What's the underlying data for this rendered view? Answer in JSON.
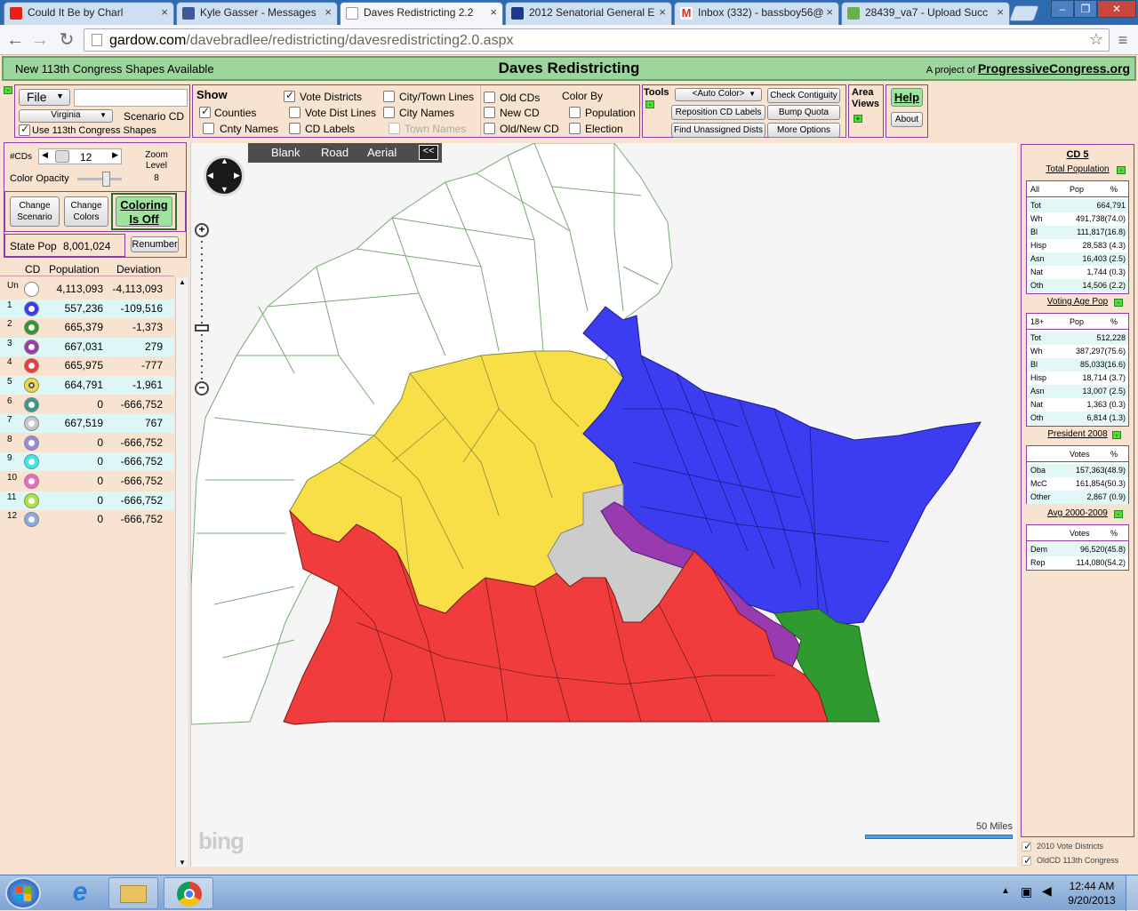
{
  "browser": {
    "tabs": [
      {
        "title": "Could It Be by Charl",
        "color": "#e62117"
      },
      {
        "title": "Kyle Gasser - Messages",
        "color": "#3b5998"
      },
      {
        "title": "Daves Redistricting 2.2",
        "color": "#ffffff"
      },
      {
        "title": "2012 Senatorial General E",
        "color": "#1a3a8c"
      },
      {
        "title": "Inbox (332) - bassboy56@",
        "color": "#d93025"
      },
      {
        "title": "28439_va7 - Upload Succ",
        "color": "#6ab04c"
      }
    ],
    "url_host": "gardow.com",
    "url_path": "/davebradlee/redistricting/davesredistricting2.0.aspx",
    "window_controls": [
      "–",
      "❐",
      "✕"
    ]
  },
  "header": {
    "notice": "New 113th Congress Shapes Available",
    "title": "Daves Redistricting",
    "project_prefix": "A project of",
    "project_link": "ProgressiveCongress.org"
  },
  "toolbar": {
    "file_label": "File",
    "state_select": "Virginia",
    "scenario": "Scenario CD",
    "use_shapes": "Use 113th Congress Shapes",
    "show_title": "Show",
    "show_items": {
      "counties": "Counties",
      "cnty_names": "Cnty Names",
      "vote_districts": "Vote Districts",
      "vote_dist_lines": "Vote Dist Lines",
      "cd_labels": "CD Labels",
      "city_town_lines": "City/Town Lines",
      "city_names": "City Names",
      "town_names": "Town Names"
    },
    "cd_items": {
      "old_cds": "Old CDs",
      "new_cd": "New CD",
      "old_new_cd": "Old/New CD"
    },
    "color_by": {
      "title": "Color By",
      "population": "Population",
      "election": "Election"
    },
    "tools_title": "Tools",
    "auto_color": "<Auto Color>",
    "reposition": "Reposition CD Labels",
    "find_unassigned": "Find Unassigned Dists",
    "check_contiguity": "Check Contiguity",
    "bump_quota": "Bump Quota",
    "more_options": "More Options",
    "area_views": "Area Views",
    "help": "Help",
    "about": "About"
  },
  "controls": {
    "num_cds_label": "#CDs",
    "num_cds": "12",
    "zoom_label": "Zoom Level",
    "zoom": "8",
    "color_opacity": "Color Opacity",
    "change_scenario": "Change Scenario",
    "change_colors": "Change Colors",
    "coloring": "Coloring Is Off",
    "state_pop_label": "State Pop",
    "state_pop": "8,001,024",
    "renumber": "Renumber"
  },
  "cd_table": {
    "headers": [
      "CD",
      "Population",
      "Deviation"
    ],
    "rows": [
      {
        "cd": "Un",
        "color": "#ffffff",
        "pop": "4,113,093",
        "dev": "-4,113,093"
      },
      {
        "cd": "1",
        "color": "#3b3bf5",
        "pop": "557,236",
        "dev": "-109,516"
      },
      {
        "cd": "2",
        "color": "#2e9a2e",
        "pop": "665,379",
        "dev": "-1,373"
      },
      {
        "cd": "3",
        "color": "#9b3aa8",
        "pop": "667,031",
        "dev": "279"
      },
      {
        "cd": "4",
        "color": "#f03c3c",
        "pop": "665,975",
        "dev": "-777"
      },
      {
        "cd": "5",
        "color": "#f5d83a",
        "pop": "664,791",
        "dev": "-1,961"
      },
      {
        "cd": "6",
        "color": "#3a9a8a",
        "pop": "0",
        "dev": "-666,752"
      },
      {
        "cd": "7",
        "color": "#c8c8c8",
        "pop": "667,519",
        "dev": "767"
      },
      {
        "cd": "8",
        "color": "#9a8ad8",
        "pop": "0",
        "dev": "-666,752"
      },
      {
        "cd": "9",
        "color": "#38e8f0",
        "pop": "0",
        "dev": "-666,752"
      },
      {
        "cd": "10",
        "color": "#f068c8",
        "pop": "0",
        "dev": "-666,752"
      },
      {
        "cd": "11",
        "color": "#a8e838",
        "pop": "0",
        "dev": "-666,752"
      },
      {
        "cd": "12",
        "color": "#88a8e8",
        "pop": "0",
        "dev": "-666,752"
      }
    ]
  },
  "map": {
    "modes": [
      "Blank",
      "Road",
      "Aerial"
    ],
    "collapse": "<<",
    "scale": "50 Miles",
    "brand": "bing"
  },
  "stats": {
    "title": "CD 5",
    "total_pop": {
      "title": "Total Population",
      "head": [
        "All",
        "Pop",
        "%"
      ],
      "rows": [
        [
          "Tot",
          "664,791"
        ],
        [
          "Wh",
          "491,738(74.0)"
        ],
        [
          "Bl",
          "111,817(16.8)"
        ],
        [
          "Hisp",
          "28,583 (4.3)"
        ],
        [
          "Asn",
          "16,403 (2.5)"
        ],
        [
          "Nat",
          "1,744 (0.3)"
        ],
        [
          "Oth",
          "14,506 (2.2)"
        ]
      ]
    },
    "vap": {
      "title": "Voting Age Pop",
      "head": [
        "18+",
        "Pop",
        "%"
      ],
      "rows": [
        [
          "Tot",
          "512,228"
        ],
        [
          "Wh",
          "387,297(75.6)"
        ],
        [
          "Bl",
          "85,033(16.6)"
        ],
        [
          "Hisp",
          "18,714 (3.7)"
        ],
        [
          "Asn",
          "13,007 (2.5)"
        ],
        [
          "Nat",
          "1,363 (0.3)"
        ],
        [
          "Oth",
          "6,814 (1.3)"
        ]
      ]
    },
    "pres": {
      "title": "President 2008",
      "head": [
        "",
        "Votes",
        "%"
      ],
      "rows": [
        [
          "Oba",
          "157,363(48.9)"
        ],
        [
          "McC",
          "161,854(50.3)"
        ],
        [
          "Other",
          "2,867 (0.9)"
        ]
      ]
    },
    "avg": {
      "title": "Avg 2000-2009",
      "head": [
        "",
        "Votes",
        "%"
      ],
      "rows": [
        [
          "Dem",
          "96,520(45.8)"
        ],
        [
          "Rep",
          "114,080(54.2)"
        ]
      ]
    },
    "vote_districts_2010": "2010 Vote Districts",
    "oldcd": "OldCD 113th Congress"
  },
  "taskbar": {
    "time": "12:44 AM",
    "date": "9/20/2013"
  }
}
